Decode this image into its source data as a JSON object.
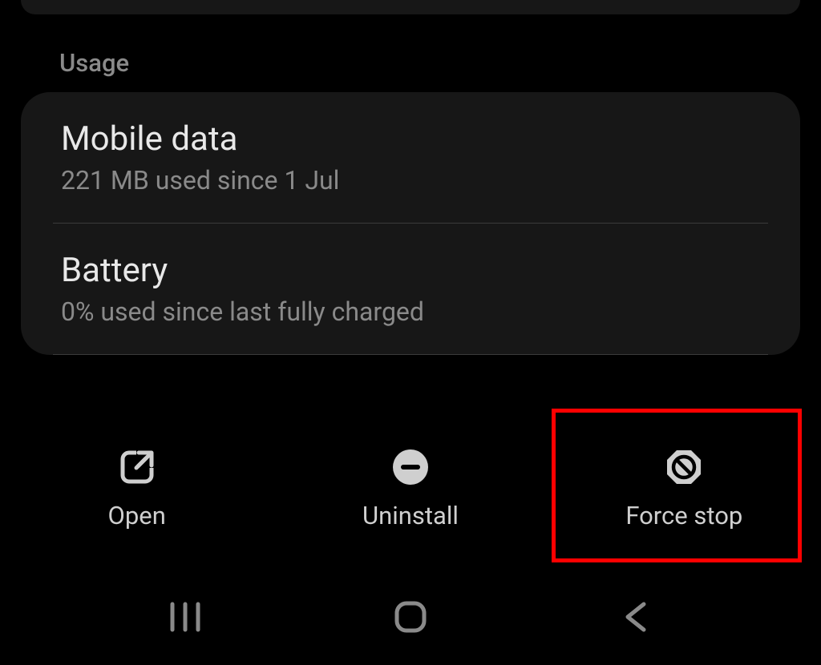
{
  "section": {
    "header": "Usage",
    "items": [
      {
        "title": "Mobile data",
        "subtitle": "221 MB used since 1 Jul"
      },
      {
        "title": "Battery",
        "subtitle": "0% used since last fully charged"
      }
    ]
  },
  "actions": {
    "open": "Open",
    "uninstall": "Uninstall",
    "force_stop": "Force stop"
  },
  "highlight": {
    "target": "force-stop-button"
  }
}
